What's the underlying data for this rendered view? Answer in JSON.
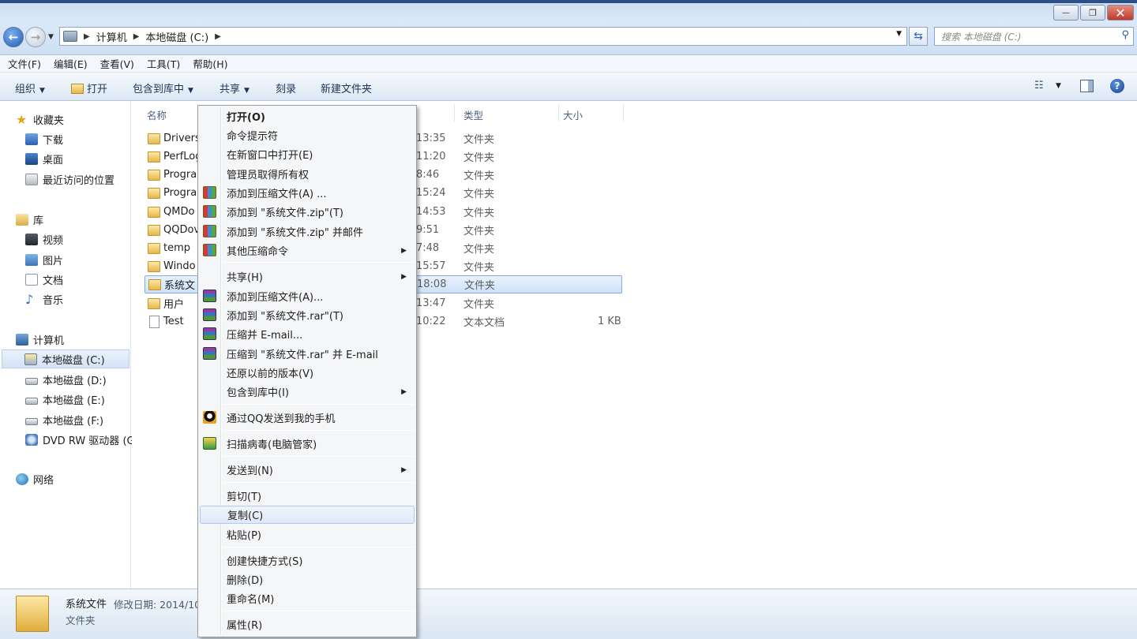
{
  "window": {
    "minimize_label": "—",
    "restore_label": "❐",
    "close_label": "✕"
  },
  "address": {
    "crumbs": [
      "计算机",
      "本地磁盘 (C:)"
    ],
    "search_placeholder": "搜索 本地磁盘 (C:)"
  },
  "menubar": {
    "items": [
      "文件(F)",
      "编辑(E)",
      "查看(V)",
      "工具(T)",
      "帮助(H)"
    ]
  },
  "toolbar": {
    "organize": "组织",
    "open": "打开",
    "include_library": "包含到库中",
    "share": "共享",
    "burn": "刻录",
    "new_folder": "新建文件夹"
  },
  "sidebar": {
    "favorites": "收藏夹",
    "downloads": "下载",
    "desktop": "桌面",
    "recent": "最近访问的位置",
    "libraries": "库",
    "videos": "视频",
    "pictures": "图片",
    "documents": "文档",
    "music": "音乐",
    "computer": "计算机",
    "drive_c": "本地磁盘 (C:)",
    "drive_d": "本地磁盘 (D:)",
    "drive_e": "本地磁盘 (E:)",
    "drive_f": "本地磁盘 (F:)",
    "dvd": "DVD RW 驱动器 (G",
    "network": "网络"
  },
  "columns": {
    "name": "名称",
    "type": "类型",
    "size": "大小"
  },
  "files": [
    {
      "name": "Drivers",
      "time": "13:35",
      "type": "文件夹",
      "size": ""
    },
    {
      "name": "PerfLog",
      "time": "11:20",
      "type": "文件夹",
      "size": ""
    },
    {
      "name": "Progra",
      "time": "8:46",
      "type": "文件夹",
      "size": ""
    },
    {
      "name": "Progra",
      "time": "15:24",
      "type": "文件夹",
      "size": ""
    },
    {
      "name": "QMDo",
      "time": "14:53",
      "type": "文件夹",
      "size": ""
    },
    {
      "name": "QQDov",
      "time": "9:51",
      "type": "文件夹",
      "size": ""
    },
    {
      "name": "temp",
      "time": "7:48",
      "type": "文件夹",
      "size": ""
    },
    {
      "name": "Windo",
      "time": "15:57",
      "type": "文件夹",
      "size": ""
    },
    {
      "name": "系统文",
      "time": "18:08",
      "type": "文件夹",
      "size": ""
    },
    {
      "name": "用户",
      "time": "13:47",
      "type": "文件夹",
      "size": ""
    },
    {
      "name": "Test",
      "time": "10:22",
      "type": "文本文档",
      "size": "1 KB"
    }
  ],
  "context_menu": {
    "open": "打开(O)",
    "cmd": "命令提示符",
    "open_new_window": "在新窗口中打开(E)",
    "take_ownership": "管理员取得所有权",
    "add_zip_archive": "添加到压缩文件(A) ...",
    "add_zip_named": "添加到 \"系统文件.zip\"(T)",
    "add_zip_mail": "添加到 \"系统文件.zip\" 并邮件",
    "other_zip": "其他压缩命令",
    "share": "共享(H)",
    "add_rar_archive": "添加到压缩文件(A)...",
    "add_rar_named": "添加到 \"系统文件.rar\"(T)",
    "compress_email": "压缩并 E-mail...",
    "compress_rar_email": "压缩到 \"系统文件.rar\" 并 E-mail",
    "restore_versions": "还原以前的版本(V)",
    "include_library": "包含到库中(I)",
    "qq_send": "通过QQ发送到我的手机",
    "scan_virus": "扫描病毒(电脑管家)",
    "send_to": "发送到(N)",
    "cut": "剪切(T)",
    "copy": "复制(C)",
    "paste": "粘贴(P)",
    "create_shortcut": "创建快捷方式(S)",
    "delete": "删除(D)",
    "rename": "重命名(M)",
    "properties": "属性(R)"
  },
  "details": {
    "name": "系统文件",
    "modified_label": "修改日期: 2014/10",
    "type": "文件夹"
  }
}
